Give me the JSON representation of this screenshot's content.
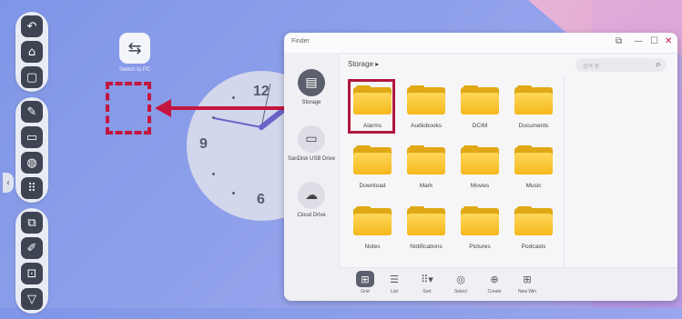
{
  "desktop": {
    "icon_label": "Switch to PC",
    "clock_numbers": {
      "twelve": "12",
      "nine": "9",
      "six": "6"
    }
  },
  "dock": {
    "groups": [
      [
        "back-icon",
        "home-icon",
        "recent-apps-icon"
      ],
      [
        "whiteboard-icon",
        "wallet-icon",
        "globe-icon",
        "apps-grid-icon"
      ],
      [
        "screen-mirror-icon",
        "pen-icon",
        "crop-icon",
        "more-icon"
      ]
    ]
  },
  "finder": {
    "title": "Finder",
    "window_controls": {
      "restore": "⧉",
      "minimize": "—",
      "maximize": "☐",
      "close": "✕"
    },
    "breadcrumb": "Storage ▸",
    "search_placeholder": "검색 중",
    "sidebar": [
      {
        "label": "Storage",
        "icon": "storage-icon",
        "active": true
      },
      {
        "label": "SanDisk USB Drive",
        "icon": "usb-drive-icon",
        "active": false
      },
      {
        "label": "Cloud Drive",
        "icon": "cloud-drive-icon",
        "active": false
      }
    ],
    "folders": [
      "Alarms",
      "Audiobooks",
      "DCIM",
      "Documents",
      "Download",
      "Mark",
      "Movies",
      "Music",
      "Notes",
      "Notifications",
      "Pictures",
      "Podcasts"
    ],
    "selected_folder": "Alarms",
    "toolbar": [
      {
        "label": "Grid",
        "icon": "grid-icon",
        "active": true
      },
      {
        "label": "List",
        "icon": "list-icon",
        "active": false
      },
      {
        "label": "Sort",
        "icon": "sort-icon",
        "active": false
      },
      {
        "label": "Select",
        "icon": "select-icon",
        "active": false
      },
      {
        "label": "Create",
        "icon": "create-folder-icon",
        "active": false
      },
      {
        "label": "New Win",
        "icon": "new-window-icon",
        "active": false
      }
    ]
  },
  "colors": {
    "highlight": "#c4163e",
    "folder": "#f5b81c",
    "dock_button": "#3e4452"
  }
}
